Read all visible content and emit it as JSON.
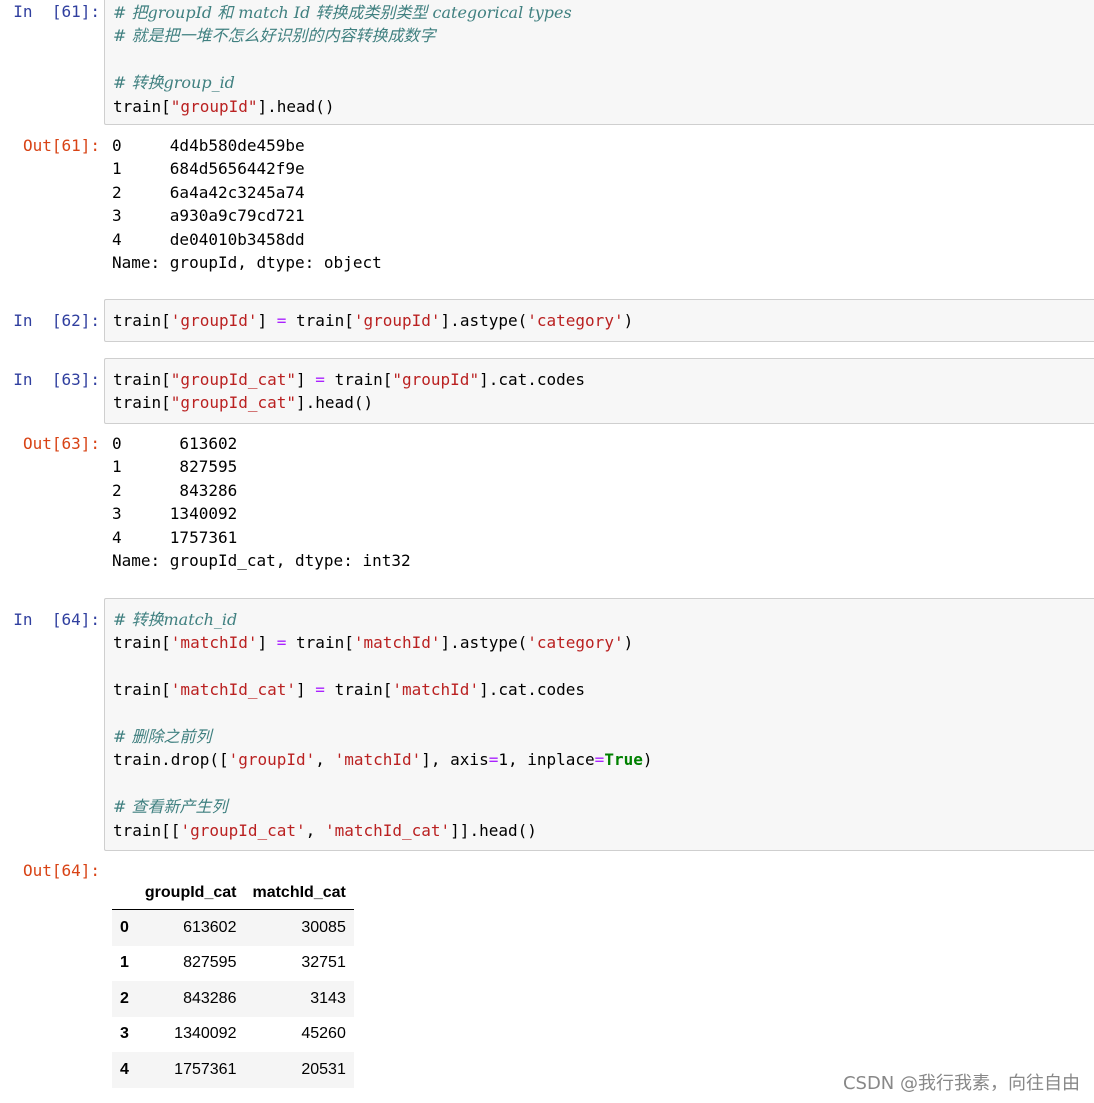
{
  "cells": {
    "c61": {
      "in_prompt": "In  [61]:",
      "out_prompt": "Out[61]:",
      "comment1": "# 把groupId 和 match Id 转换成类别类型 categorical types",
      "comment2": "# 就是把一堆不怎么好识别的内容转换成数字",
      "comment3": "# 转换group_id",
      "code_a": "train[",
      "code_str": "\"groupId\"",
      "code_b": "].head()",
      "output": [
        "0     4d4b580de459be",
        "1     684d5656442f9e",
        "2     6a4a42c3245a74",
        "3     a930a9c79cd721",
        "4     de04010b3458dd",
        "Name: groupId, dtype: object"
      ]
    },
    "c62": {
      "in_prompt": "In  [62]:",
      "p1": "train[",
      "s1": "'groupId'",
      "p2": "] ",
      "eq": "=",
      "p3": " train[",
      "s2": "'groupId'",
      "p4": "].astype(",
      "s3": "'category'",
      "p5": ")"
    },
    "c63": {
      "in_prompt": "In  [63]:",
      "out_prompt": "Out[63]:",
      "l1_a": "train[",
      "l1_s1": "\"groupId_cat\"",
      "l1_b": "] ",
      "l1_eq": "=",
      "l1_c": " train[",
      "l1_s2": "\"groupId\"",
      "l1_d": "].cat.codes",
      "l2_a": "train[",
      "l2_s1": "\"groupId_cat\"",
      "l2_b": "].head()",
      "output": [
        "0      613602",
        "1      827595",
        "2      843286",
        "3     1340092",
        "4     1757361",
        "Name: groupId_cat, dtype: int32"
      ]
    },
    "c64": {
      "in_prompt": "In  [64]:",
      "out_prompt": "Out[64]:",
      "comment1": "# 转换match_id",
      "l2_a": "train[",
      "l2_s1": "'matchId'",
      "l2_b": "] ",
      "l2_eq": "=",
      "l2_c": " train[",
      "l2_s2": "'matchId'",
      "l2_d": "].astype(",
      "l2_s3": "'category'",
      "l2_e": ")",
      "l4_a": "train[",
      "l4_s1": "'matchId_cat'",
      "l4_b": "] ",
      "l4_eq": "=",
      "l4_c": " train[",
      "l4_s2": "'matchId'",
      "l4_d": "].cat.codes",
      "comment2": "# 删除之前列",
      "l7_a": "train.drop([",
      "l7_s1": "'groupId'",
      "l7_b": ", ",
      "l7_s2": "'matchId'",
      "l7_c": "], axis",
      "l7_eq1": "=",
      "l7_d": "1, inplace",
      "l7_eq2": "=",
      "l7_kw": "True",
      "l7_e": ")",
      "comment3": "# 查看新产生列",
      "l9_a": "train[[",
      "l9_s1": "'groupId_cat'",
      "l9_b": ", ",
      "l9_s2": "'matchId_cat'",
      "l9_c": "]].head()",
      "table": {
        "columns": [
          "",
          "groupId_cat",
          "matchId_cat"
        ],
        "rows": [
          [
            "0",
            "613602",
            "30085"
          ],
          [
            "1",
            "827595",
            "32751"
          ],
          [
            "2",
            "843286",
            "3143"
          ],
          [
            "3",
            "1340092",
            "45260"
          ],
          [
            "4",
            "1757361",
            "20531"
          ]
        ]
      }
    }
  },
  "watermark": "CSDN @我行我素，向往自由",
  "colors": {
    "in_prompt": "#303f9f",
    "out_prompt": "#d84315",
    "comment": "#408080",
    "string": "#ba2121",
    "operator": "#aa22ff",
    "keyword": "#008000",
    "cell_bg": "#f7f7f7",
    "cell_border": "#cfcfcf"
  }
}
